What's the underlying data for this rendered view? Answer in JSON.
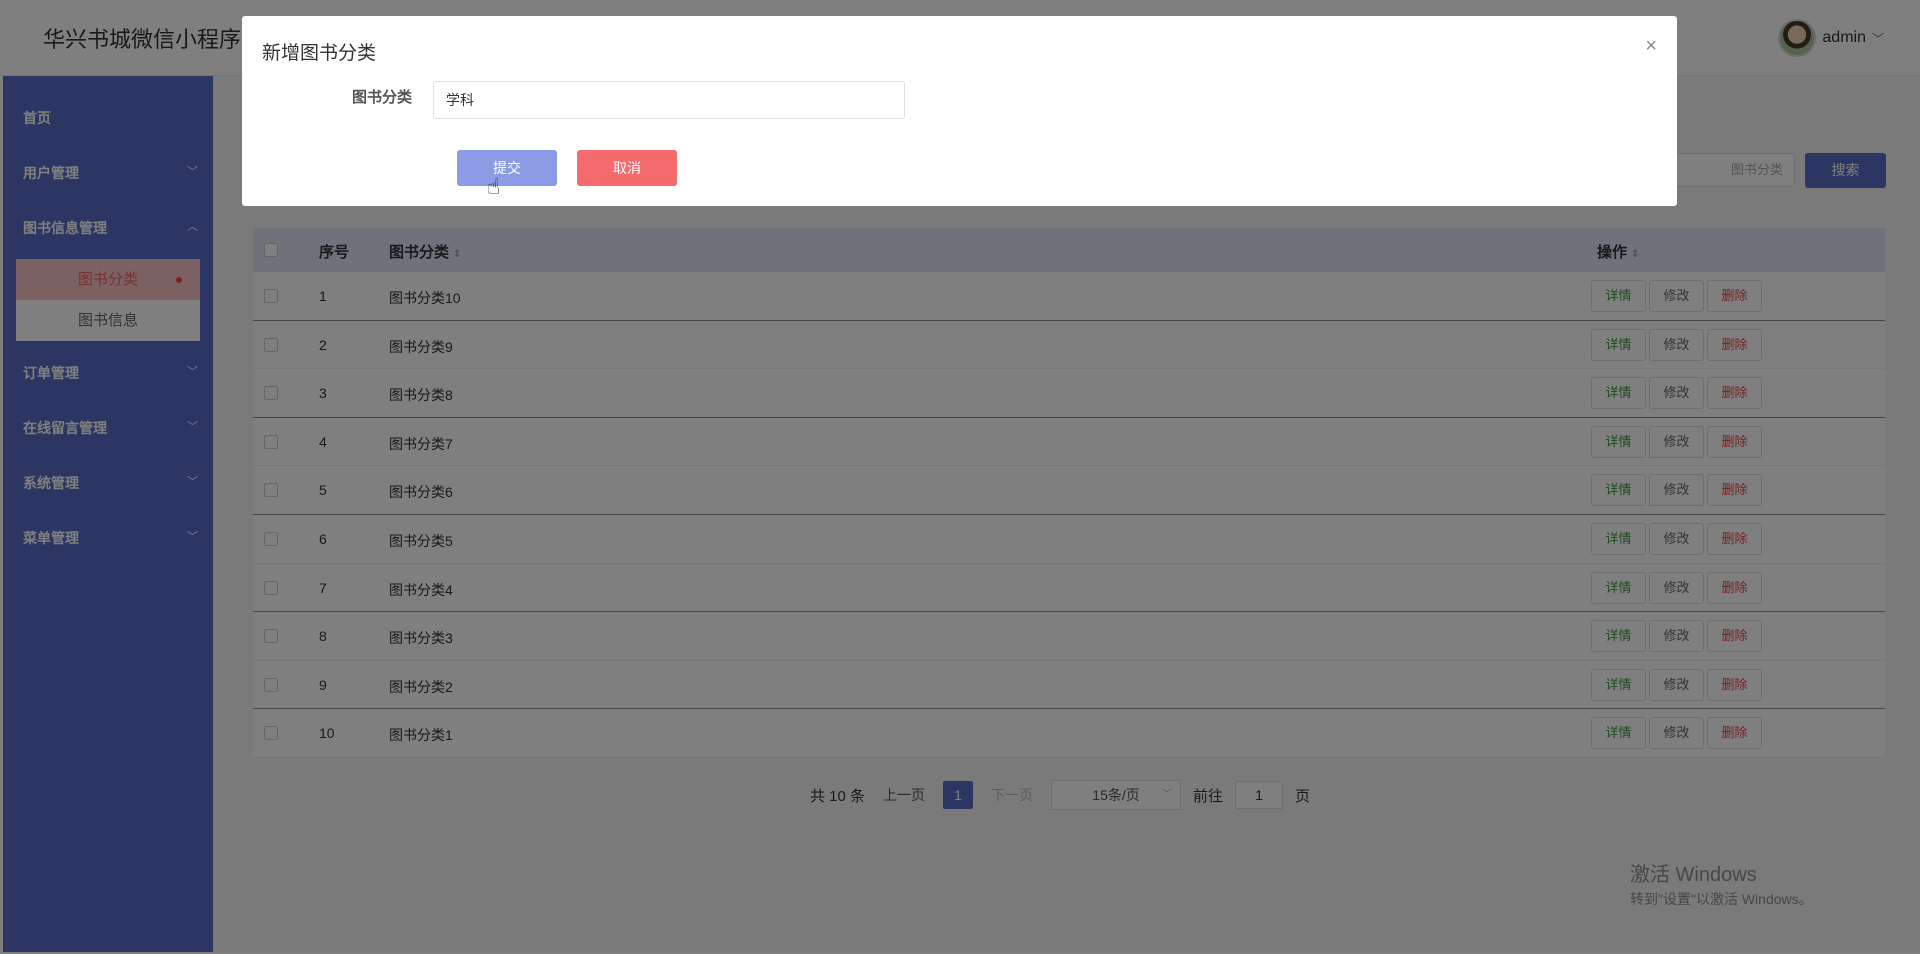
{
  "header": {
    "app_title": "华兴书城微信小程序",
    "user_name": "admin"
  },
  "sidebar": {
    "items": [
      {
        "label": "首页",
        "has_arrow": false
      },
      {
        "label": "用户管理",
        "arrow": "﹀"
      },
      {
        "label": "图书信息管理",
        "arrow": "︿"
      },
      {
        "label": "订单管理",
        "arrow": "﹀"
      },
      {
        "label": "在线留言管理",
        "arrow": "﹀"
      },
      {
        "label": "系统管理",
        "arrow": "﹀"
      },
      {
        "label": "菜单管理",
        "arrow": "﹀"
      }
    ],
    "submenu": [
      {
        "label": "图书分类",
        "active": true
      },
      {
        "label": "图书信息",
        "active": false
      }
    ]
  },
  "search": {
    "placeholder_visible": "图书分类",
    "button_label": "搜索"
  },
  "table": {
    "columns": {
      "index": "序号",
      "category": "图书分类",
      "actions": "操作"
    },
    "rows": [
      {
        "index": "1",
        "category": "图书分类10"
      },
      {
        "index": "2",
        "category": "图书分类9"
      },
      {
        "index": "3",
        "category": "图书分类8"
      },
      {
        "index": "4",
        "category": "图书分类7"
      },
      {
        "index": "5",
        "category": "图书分类6"
      },
      {
        "index": "6",
        "category": "图书分类5"
      },
      {
        "index": "7",
        "category": "图书分类4"
      },
      {
        "index": "8",
        "category": "图书分类3"
      },
      {
        "index": "9",
        "category": "图书分类2"
      },
      {
        "index": "10",
        "category": "图书分类1"
      }
    ],
    "action_labels": {
      "detail": "详情",
      "edit": "修改",
      "delete": "删除"
    }
  },
  "pagination": {
    "total": "共 10 条",
    "prev": "上一页",
    "current": "1",
    "next": "下一页",
    "page_size": "15条/页",
    "goto": "前往",
    "goto_value": "1",
    "page_unit": "页"
  },
  "watermark": {
    "line1": "激活 Windows",
    "line2": "转到\"设置\"以激活 Windows。"
  },
  "dialog": {
    "title": "新增图书分类",
    "field_label": "图书分类",
    "field_value": "学科",
    "submit_label": "提交",
    "cancel_label": "取消",
    "close_icon": "×"
  },
  "colors": {
    "primary": "#5a6cc4",
    "danger": "#f46a6e",
    "active_menu_bg": "#f7c3c3"
  }
}
